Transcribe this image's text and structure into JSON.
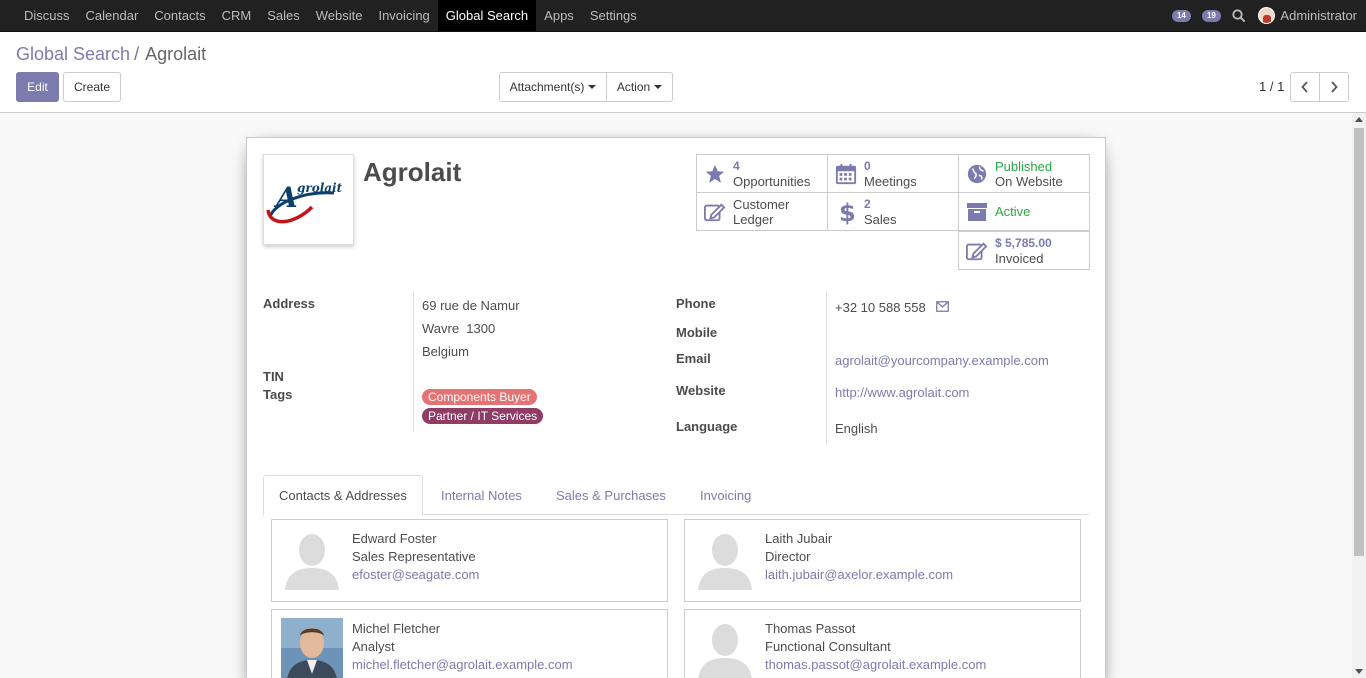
{
  "topnav": {
    "menu": [
      "Discuss",
      "Calendar",
      "Contacts",
      "CRM",
      "Sales",
      "Website",
      "Invoicing",
      "Global Search",
      "Apps",
      "Settings"
    ],
    "active": "Global Search",
    "activities_count": "14",
    "messages_count": "19",
    "user": "Administrator"
  },
  "breadcrumb": {
    "parent": "Global Search",
    "separator": "/",
    "current": "Agrolait"
  },
  "buttons": {
    "edit": "Edit",
    "create": "Create",
    "attachments": "Attachment(s)",
    "action": "Action"
  },
  "pager": {
    "value": "1 / 1"
  },
  "record": {
    "name": "Agrolait",
    "logo_text": "Agrolait",
    "smart_buttons": {
      "opportunities": {
        "count": "4",
        "label": "Opportunities"
      },
      "meetings": {
        "count": "0",
        "label": "Meetings"
      },
      "published": {
        "line1": "Published",
        "line2": "On Website"
      },
      "ledger": {
        "line1": "Customer",
        "line2": "Ledger"
      },
      "sales": {
        "count": "2",
        "label": "Sales"
      },
      "active": {
        "label": "Active"
      },
      "invoiced": {
        "amount": "$ 5,785.00",
        "label": "Invoiced"
      }
    },
    "fields": {
      "address_label": "Address",
      "street": "69 rue de Namur",
      "city": "Wavre  1300",
      "country": "Belgium",
      "tin_label": "TIN",
      "tags_label": "Tags",
      "tags": [
        {
          "name": "Components Buyer",
          "color": "#e57373"
        },
        {
          "name": "Partner / IT Services",
          "color": "#8f3c67"
        }
      ],
      "phone_label": "Phone",
      "phone": "+32 10 588 558",
      "mobile_label": "Mobile",
      "email_label": "Email",
      "email": "agrolait@yourcompany.example.com",
      "website_label": "Website",
      "website": "http://www.agrolait.com",
      "language_label": "Language",
      "language": "English"
    },
    "tabs": [
      "Contacts & Addresses",
      "Internal Notes",
      "Sales & Purchases",
      "Invoicing"
    ],
    "active_tab": "Contacts & Addresses",
    "contacts": [
      {
        "name": "Edward Foster",
        "role": "Sales Representative",
        "email": "efoster@seagate.com",
        "photo": "placeholder"
      },
      {
        "name": "Laith Jubair",
        "role": "Director",
        "email": "laith.jubair@axelor.example.com",
        "photo": "placeholder"
      },
      {
        "name": "Michel Fletcher",
        "role": "Analyst",
        "email": "michel.fletcher@agrolait.example.com",
        "photo": "portrait"
      },
      {
        "name": "Thomas Passot",
        "role": "Functional Consultant",
        "email": "thomas.passot@agrolait.example.com",
        "photo": "placeholder"
      }
    ]
  },
  "colors": {
    "accent": "#7c7bad",
    "navbar": "#212121",
    "green": "#28a745"
  }
}
